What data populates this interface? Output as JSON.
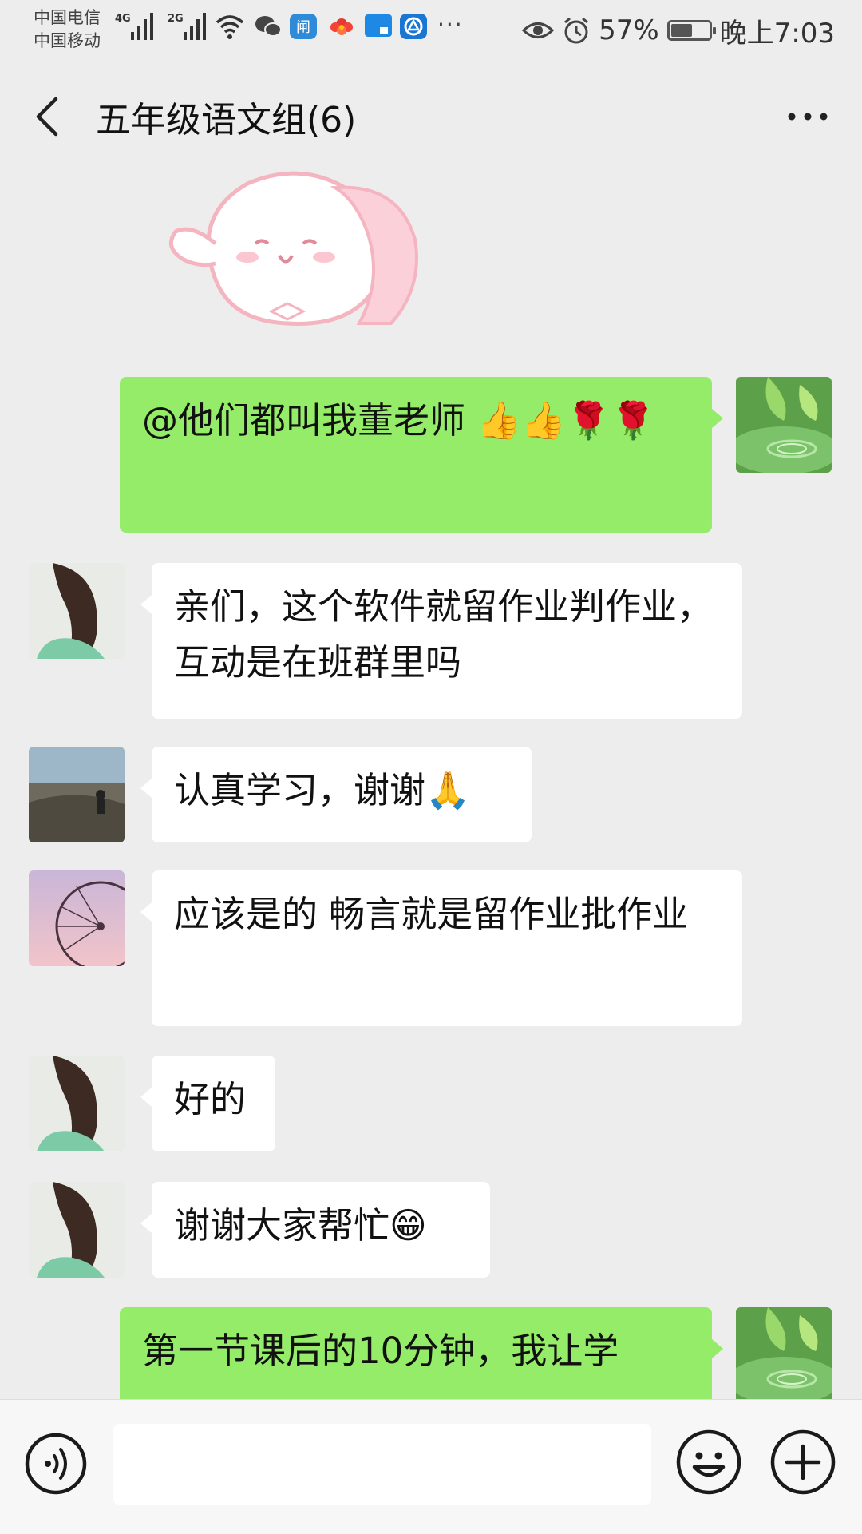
{
  "status_bar": {
    "carrier1": "中国电信",
    "carrier2": "中国移动",
    "net1": "4G",
    "net2": "2G",
    "more": "···",
    "battery_text": "57%",
    "battery_level": 0.57,
    "time": "晚上7:03"
  },
  "header": {
    "title": "五年级语文组(6)",
    "back_icon": "back-chevron-icon",
    "more_icon": "more-dots-icon"
  },
  "messages": [
    {
      "side": "out",
      "text": "@他们都叫我董老师 👍👍🌹🌹",
      "avatar": "leaf-water-avatar"
    },
    {
      "side": "in",
      "text": "亲们，这个软件就留作业判作业，互动是在班群里吗",
      "avatar": "girl-hair-avatar"
    },
    {
      "side": "in",
      "text": "认真学习，谢谢🙏",
      "avatar": "landscape-avatar"
    },
    {
      "side": "in",
      "text": "应该是的 畅言就是留作业批作业",
      "avatar": "ferris-wheel-avatar"
    },
    {
      "side": "in",
      "text": "好的",
      "avatar": "girl-hair-avatar"
    },
    {
      "side": "in",
      "text": "谢谢大家帮忙😁",
      "avatar": "girl-hair-avatar"
    },
    {
      "side": "out",
      "text": "第一节课后的10分钟，我让学",
      "avatar": "leaf-water-avatar"
    }
  ],
  "input_bar": {
    "voice_icon": "voice-icon",
    "emoji_icon": "emoji-icon",
    "plus_icon": "plus-icon",
    "input_value": ""
  },
  "colors": {
    "background": "#ededed",
    "outgoing_bubble": "#95ec69",
    "incoming_bubble": "#ffffff"
  }
}
